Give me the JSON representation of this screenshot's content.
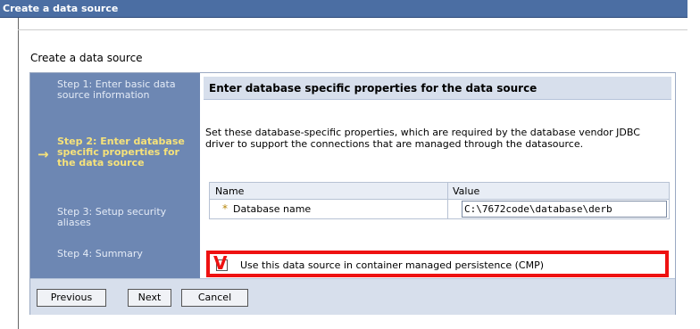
{
  "window": {
    "title": "Create a data source"
  },
  "section_label": "Create a data source",
  "steps": [
    {
      "label": "Step 1: Enter basic data source information",
      "current": false
    },
    {
      "label": "Step 2: Enter database specific properties for the data source",
      "current": true
    },
    {
      "label": "Step 3: Setup security aliases",
      "current": false
    },
    {
      "label": "Step 4: Summary",
      "current": false
    }
  ],
  "content": {
    "header": "Enter database specific properties for the data source",
    "description": "Set these database-specific properties, which are required by the database vendor JDBC driver to support the connections that are managed through the datasource."
  },
  "table": {
    "columns": [
      "Name",
      "Value"
    ],
    "rows": [
      {
        "required_mark": "*",
        "name": "Database name",
        "value": "C:\\7672code\\database\\derb"
      }
    ]
  },
  "cmp": {
    "label": "Use this data source in container managed persistence (CMP)",
    "checked": true,
    "check_glyph": "V"
  },
  "buttons": {
    "previous": "Previous",
    "next": "Next",
    "cancel": "Cancel"
  },
  "colors": {
    "title_bar": "#4b6ea3",
    "steps_panel": "#6d87b3",
    "current_step": "#f6e27a",
    "highlight": "#ee1111",
    "header_bg": "#d7dfec"
  }
}
